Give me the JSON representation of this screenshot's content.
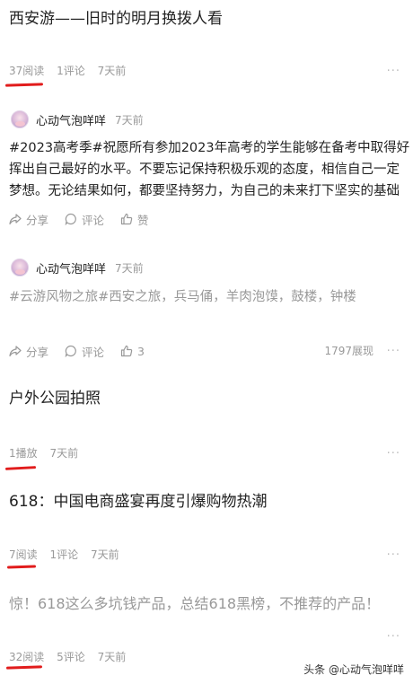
{
  "items": [
    {
      "title": "西安游——旧时的明月换拨人看",
      "reads": "37阅读",
      "comments": "1评论",
      "time": "7天前"
    },
    {
      "author": "心动气泡咩咩",
      "time": "7天前",
      "text": "#2023高考季#祝愿所有参加2023年高考的学生能够在备考中取得好挥出自己最好的水平。不要忘记保持积极乐观的态度，相信自己一定梦想。无论结果如何，都要坚持努力，为自己的未来打下坚实的基础",
      "share": "分享",
      "comment": "评论",
      "like": "赞"
    },
    {
      "author": "心动气泡咩咩",
      "time": "7天前",
      "text": "#云游风物之旅#西安之旅，兵马俑，羊肉泡馍，鼓楼，钟楼",
      "share": "分享",
      "comment": "评论",
      "like": "3",
      "views": "1797展现"
    },
    {
      "title": "户外公园拍照",
      "plays": "1播放",
      "time": "7天前"
    },
    {
      "title": "618：中国电商盛宴再度引爆购物热潮",
      "reads": "7阅读",
      "comments": "1评论",
      "time": "7天前"
    },
    {
      "title": "惊！618这么多坑钱产品，总结618黑榜，不推荐的产品！",
      "reads": "32阅读",
      "comments": "5评论",
      "time": "7天前"
    }
  ],
  "more_icon": "···",
  "accent_color": "#e11c1c",
  "watermark": "头条 @心动气泡咩咩"
}
